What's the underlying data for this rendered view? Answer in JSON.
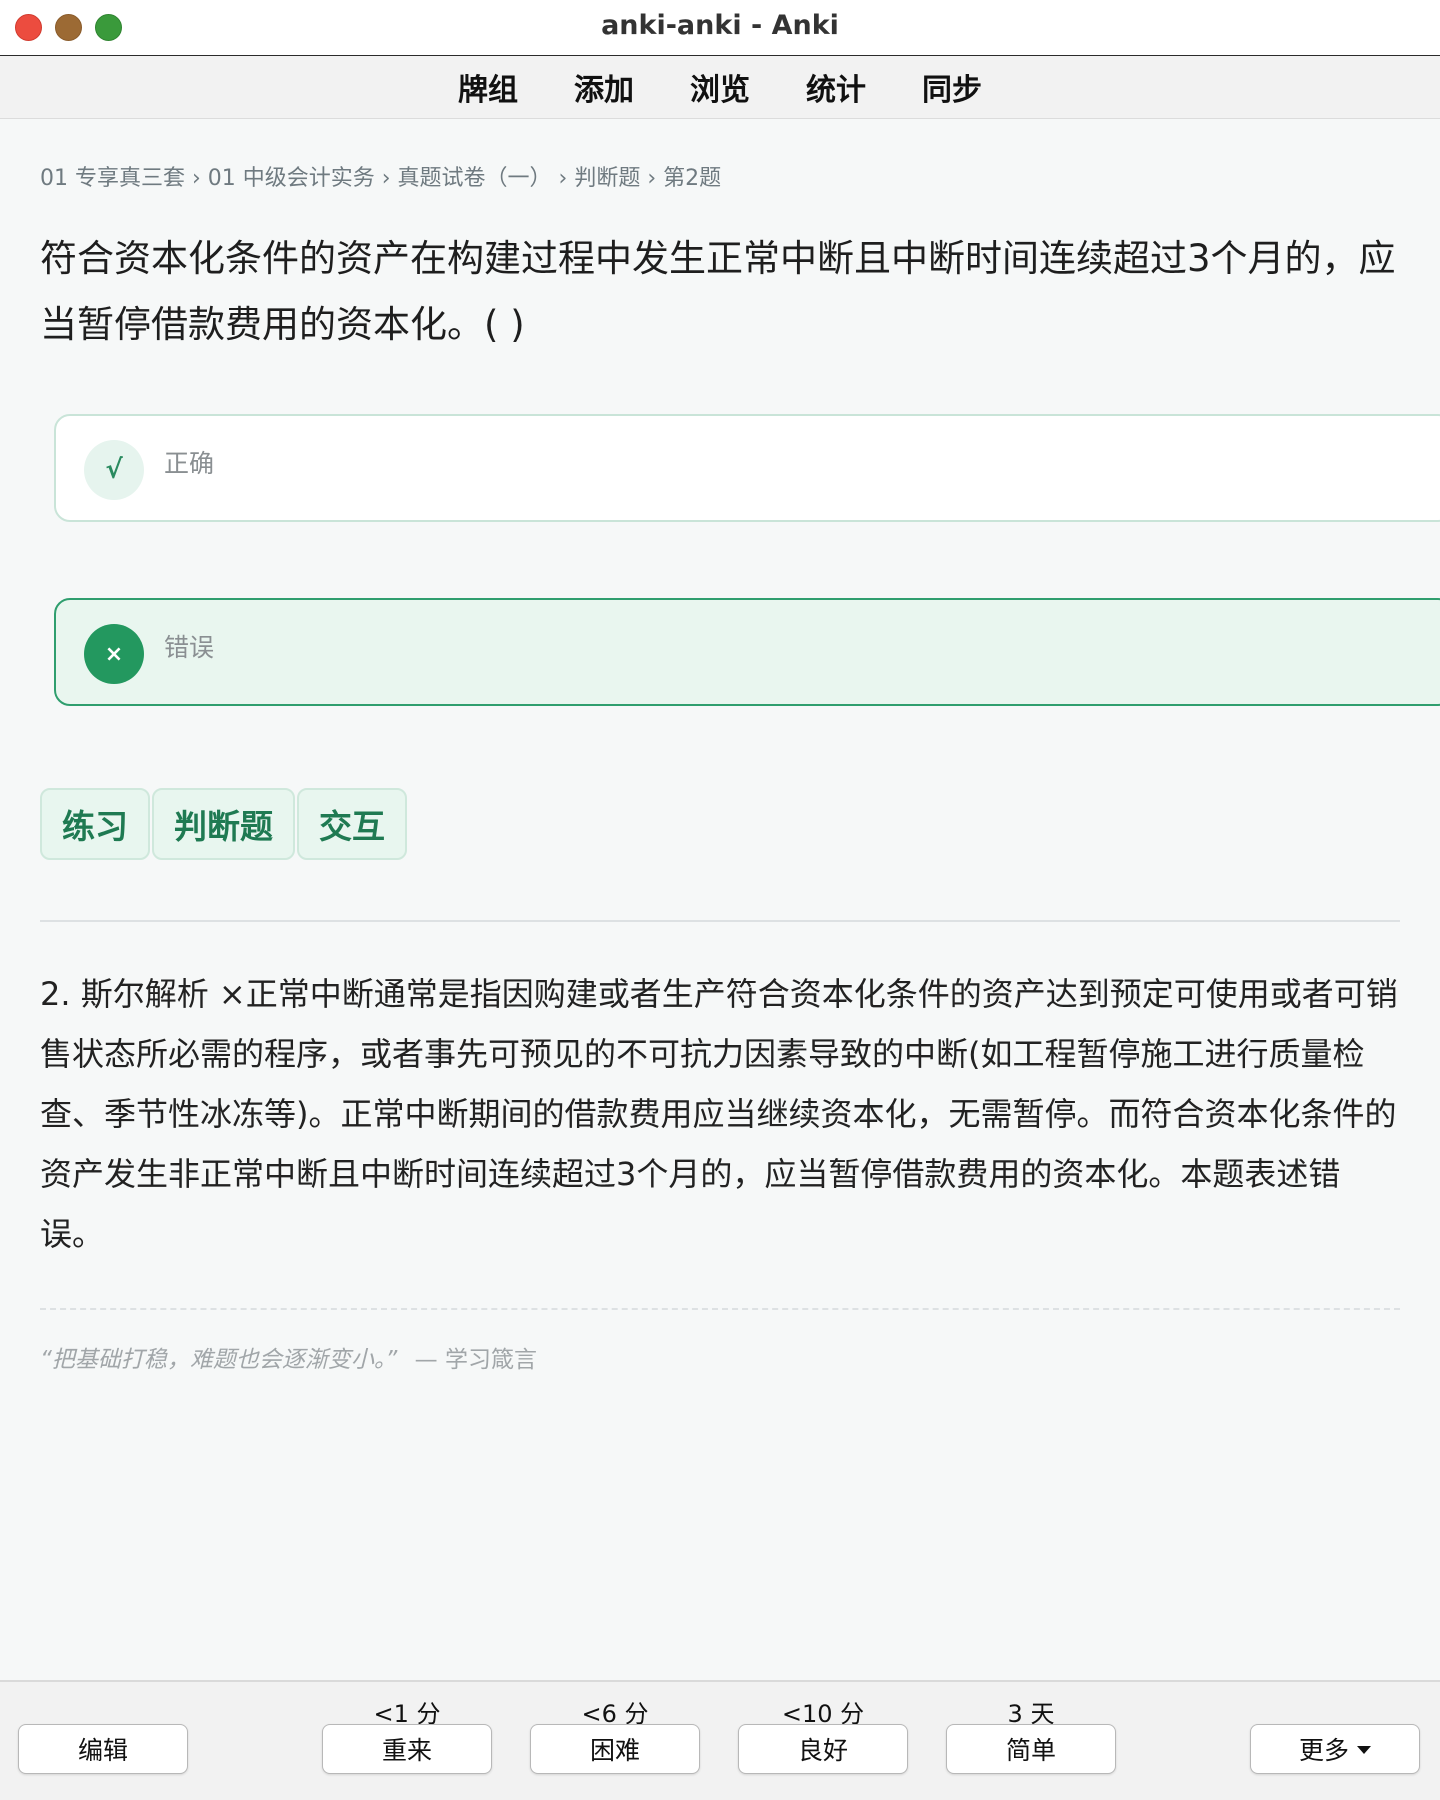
{
  "window": {
    "title": "anki-anki - Anki"
  },
  "toolbar": {
    "items": [
      "牌组",
      "添加",
      "浏览",
      "统计",
      "同步"
    ]
  },
  "card": {
    "breadcrumb": "01 专享真三套 › 01 中级会计实务 › 真题试卷（一） › 判断题 › 第2题",
    "question": "符合资本化条件的资产在构建过程中发生正常中断且中断时间连续超过3个月的，应当暂停借款费用的资本化。( )",
    "options": [
      {
        "mark": "√",
        "label": "正确"
      },
      {
        "mark": "×",
        "label": "错误"
      }
    ],
    "tags": [
      "练习",
      "判断题",
      "交互"
    ],
    "explanation": "2. 斯尔解析 ×正常中断通常是指因购建或者生产符合资本化条件的资产达到预定可使用或者可销售状态所必需的程序，或者事先可预见的不可抗力因素导致的中断(如工程暂停施工进行质量检查、季节性冰冻等)。正常中断期间的借款费用应当继续资本化，无需暂停。而符合资本化条件的资产发生非正常中断且中断时间连续超过3个月的，应当暂停借款费用的资本化。本题表述错误。",
    "quote": {
      "text": "“把基础打稳，难题也会逐渐变小。”",
      "source": "— 学习箴言"
    }
  },
  "bottom": {
    "edit_label": "编辑",
    "more_label": "更多",
    "answers": [
      {
        "interval": "<1 分",
        "label": "重来"
      },
      {
        "interval": "<6 分",
        "label": "困难"
      },
      {
        "interval": "<10 分",
        "label": "良好"
      },
      {
        "interval": "3 天",
        "label": "简单"
      }
    ]
  },
  "colors": {
    "accent": "#23985f",
    "selected_bg": "#e9f6ef",
    "tag_text": "#1f7a52"
  }
}
